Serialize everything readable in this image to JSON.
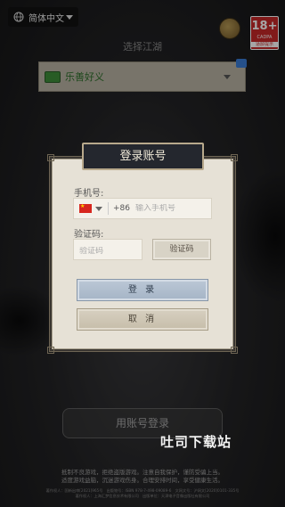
{
  "top": {
    "language": "简体中文",
    "age_badge": {
      "age": "18+",
      "org": "CADPA",
      "tip": "适龄提示"
    }
  },
  "server": {
    "heading": "选择江湖",
    "name": "乐善好义"
  },
  "dialog": {
    "title": "登录账号",
    "phone_label": "手机号:",
    "country_code": "+86",
    "phone_placeholder": "输入手机号",
    "code_label": "验证码:",
    "code_placeholder": "验证码",
    "get_code_label": "验证码",
    "login_label": "登 录",
    "cancel_label": "取 消"
  },
  "account_login_label": "用账号登录",
  "watermark": "吐司下载站",
  "footer": {
    "health_line1": "抵制不良游戏，拒绝盗版游戏。注意自我保护，谨防受骗上当。",
    "health_line2": "适度游戏益脑，沉迷游戏伤身。合理安排时间，享受健康生活。",
    "reg_line1": "著作权人：国新出审[2021]965号　出版物号：ISBN 978-7-498-09089-6　文网文号：沪网文[2020]0101-335号",
    "reg_line2": "著作权人：上海汇梦信息技术有限公司　出版单位：天津电子音像出版社有限公司"
  },
  "colors": {
    "login_button": "#a5b4c6",
    "cancel_button": "#c6bda9",
    "dialog_bg": "#e6e1d6",
    "server_name": "#2c6e2a"
  }
}
